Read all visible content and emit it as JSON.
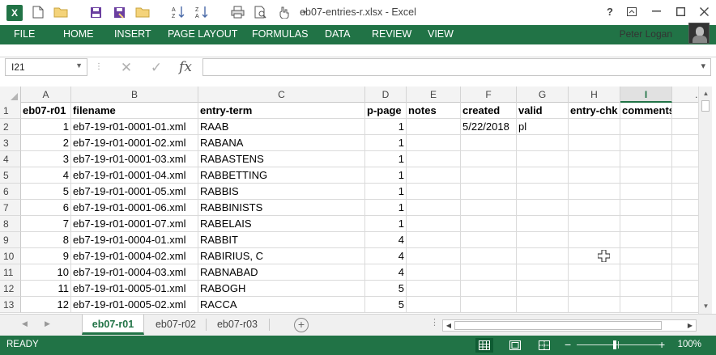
{
  "app": {
    "window_title": "eb07-entries-r.xlsx - Excel",
    "logo_letter": "X",
    "user_name": "Peter Logan",
    "help_symbol": "?"
  },
  "ribbon": {
    "tabs": [
      {
        "label": "FILE"
      },
      {
        "label": "HOME"
      },
      {
        "label": "INSERT"
      },
      {
        "label": "PAGE LAYOUT"
      },
      {
        "label": "FORMULAS"
      },
      {
        "label": "DATA"
      },
      {
        "label": "REVIEW"
      },
      {
        "label": "VIEW"
      }
    ]
  },
  "formula_bar": {
    "name_box": "I21",
    "fx_label": "fx",
    "formula_value": ""
  },
  "grid": {
    "columns": [
      "A",
      "B",
      "C",
      "D",
      "E",
      "F",
      "G",
      "H",
      "I"
    ],
    "selected_column": "I",
    "overflow_column_marker": ".",
    "rows": [
      {
        "num": "1",
        "cells": [
          "eb07-r01",
          "filename",
          "entry-term",
          "p-page",
          "notes",
          "created",
          "valid",
          "entry-chk",
          "comments"
        ]
      },
      {
        "num": "2",
        "cells": [
          "1",
          "eb7-19-r01-0001-01.xml",
          "RAAB",
          "1",
          "",
          "5/22/2018",
          "pl",
          "",
          ""
        ]
      },
      {
        "num": "3",
        "cells": [
          "2",
          "eb7-19-r01-0001-02.xml",
          "RABANA",
          "1",
          "",
          "",
          "",
          "",
          ""
        ]
      },
      {
        "num": "4",
        "cells": [
          "3",
          "eb7-19-r01-0001-03.xml",
          "RABASTENS",
          "1",
          "",
          "",
          "",
          "",
          ""
        ]
      },
      {
        "num": "5",
        "cells": [
          "4",
          "eb7-19-r01-0001-04.xml",
          "RABBETTING",
          "1",
          "",
          "",
          "",
          "",
          ""
        ]
      },
      {
        "num": "6",
        "cells": [
          "5",
          "eb7-19-r01-0001-05.xml",
          "RABBIS",
          "1",
          "",
          "",
          "",
          "",
          ""
        ]
      },
      {
        "num": "7",
        "cells": [
          "6",
          "eb7-19-r01-0001-06.xml",
          "RABBINISTS",
          "1",
          "",
          "",
          "",
          "",
          ""
        ]
      },
      {
        "num": "8",
        "cells": [
          "7",
          "eb7-19-r01-0001-07.xml",
          "RABELAIS",
          "1",
          "",
          "",
          "",
          "",
          ""
        ]
      },
      {
        "num": "9",
        "cells": [
          "8",
          "eb7-19-r01-0004-01.xml",
          "RABBIT",
          "4",
          "",
          "",
          "",
          "",
          ""
        ]
      },
      {
        "num": "10",
        "cells": [
          "9",
          "eb7-19-r01-0004-02.xml",
          "RABIRIUS, C",
          "4",
          "",
          "",
          "",
          "",
          ""
        ]
      },
      {
        "num": "11",
        "cells": [
          "10",
          "eb7-19-r01-0004-03.xml",
          "RABNABAD",
          "4",
          "",
          "",
          "",
          "",
          ""
        ]
      },
      {
        "num": "12",
        "cells": [
          "11",
          "eb7-19-r01-0005-01.xml",
          "RABOGH",
          "5",
          "",
          "",
          "",
          "",
          ""
        ]
      },
      {
        "num": "13",
        "cells": [
          "12",
          "eb7-19-r01-0005-02.xml",
          "RACCA",
          "5",
          "",
          "",
          "",
          "",
          ""
        ]
      }
    ]
  },
  "sheets": {
    "tabs": [
      {
        "label": "eb07-r01",
        "active": true
      },
      {
        "label": "eb07-r02",
        "active": false
      },
      {
        "label": "eb07-r03",
        "active": false
      }
    ],
    "add_symbol": "+"
  },
  "status_bar": {
    "status": "READY",
    "zoom_minus": "−",
    "zoom_plus": "+",
    "zoom_percent": "100%",
    "zoom_level": 100
  },
  "colors": {
    "accent": "#217346",
    "grid_line": "#dadada",
    "header_bg": "#f3f3f3"
  }
}
